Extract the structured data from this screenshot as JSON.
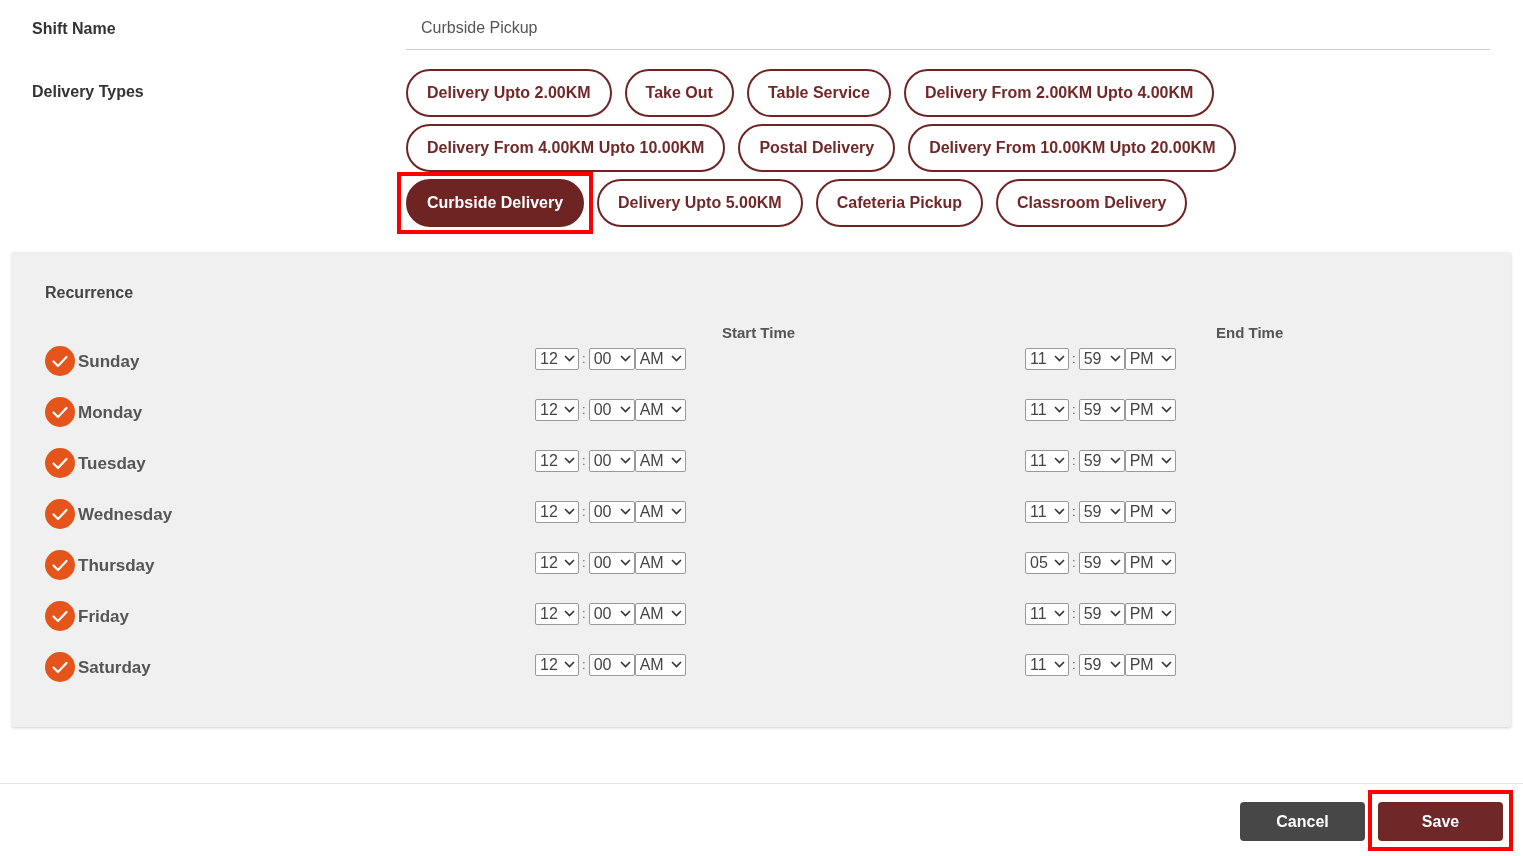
{
  "shift_name": {
    "label": "Shift Name",
    "value": "Curbside Pickup"
  },
  "delivery_types": {
    "label": "Delivery Types",
    "items": [
      {
        "label": "Delivery Upto 2.00KM",
        "selected": false,
        "highlighted": false
      },
      {
        "label": "Take Out",
        "selected": false,
        "highlighted": false
      },
      {
        "label": "Table Service",
        "selected": false,
        "highlighted": false
      },
      {
        "label": "Delivery From 2.00KM Upto 4.00KM",
        "selected": false,
        "highlighted": false
      },
      {
        "label": "Delivery From 4.00KM Upto 10.00KM",
        "selected": false,
        "highlighted": false
      },
      {
        "label": "Postal Delivery",
        "selected": false,
        "highlighted": false
      },
      {
        "label": "Delivery From 10.00KM Upto 20.00KM",
        "selected": false,
        "highlighted": false
      },
      {
        "label": "Curbside Delivery",
        "selected": true,
        "highlighted": true
      },
      {
        "label": "Delivery Upto 5.00KM",
        "selected": false,
        "highlighted": false
      },
      {
        "label": "Cafeteria Pickup",
        "selected": false,
        "highlighted": false
      },
      {
        "label": "Classroom Delivery",
        "selected": false,
        "highlighted": false
      }
    ]
  },
  "recurrence": {
    "title": "Recurrence",
    "start_header": "Start Time",
    "end_header": "End Time",
    "days": [
      {
        "day": "Sunday",
        "checked": true,
        "start": {
          "hour": "12",
          "separator": ":",
          "minute": "00",
          "period": "AM"
        },
        "end": {
          "hour": "11",
          "separator": ":",
          "minute": "59",
          "period": "PM"
        }
      },
      {
        "day": "Monday",
        "checked": true,
        "start": {
          "hour": "12",
          "separator": ":",
          "minute": "00",
          "period": "AM"
        },
        "end": {
          "hour": "11",
          "separator": ":",
          "minute": "59",
          "period": "PM"
        }
      },
      {
        "day": "Tuesday",
        "checked": true,
        "start": {
          "hour": "12",
          "separator": ":",
          "minute": "00",
          "period": "AM"
        },
        "end": {
          "hour": "11",
          "separator": ":",
          "minute": "59",
          "period": "PM"
        }
      },
      {
        "day": "Wednesday",
        "checked": true,
        "start": {
          "hour": "12",
          "separator": ":",
          "minute": "00",
          "period": "AM"
        },
        "end": {
          "hour": "11",
          "separator": ":",
          "minute": "59",
          "period": "PM"
        }
      },
      {
        "day": "Thursday",
        "checked": true,
        "start": {
          "hour": "12",
          "separator": ":",
          "minute": "00",
          "period": "AM"
        },
        "end": {
          "hour": "05",
          "separator": ":",
          "minute": "59",
          "period": "PM"
        }
      },
      {
        "day": "Friday",
        "checked": true,
        "start": {
          "hour": "12",
          "separator": ":",
          "minute": "00",
          "period": "AM"
        },
        "end": {
          "hour": "11",
          "separator": ":",
          "minute": "59",
          "period": "PM"
        }
      },
      {
        "day": "Saturday",
        "checked": true,
        "start": {
          "hour": "12",
          "separator": ":",
          "minute": "00",
          "period": "AM"
        },
        "end": {
          "hour": "11",
          "separator": ":",
          "minute": "59",
          "period": "PM"
        }
      }
    ]
  },
  "buttons": [
    {
      "label": "Cancel",
      "kind": "secondary",
      "highlighted": false
    },
    {
      "label": "Save",
      "kind": "primary",
      "highlighted": true
    }
  ]
}
